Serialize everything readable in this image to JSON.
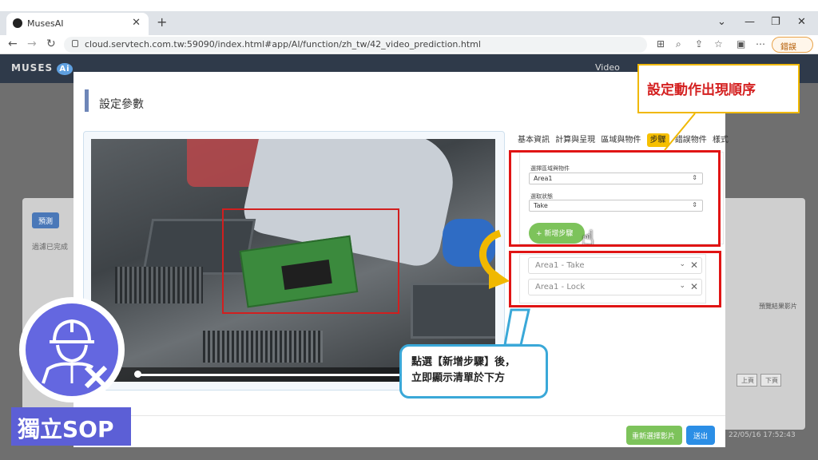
{
  "browser": {
    "tab_title": "MusesAI",
    "url": "cloud.servtech.com.tw:59090/index.html#app/AI/function/zh_tw/42_video_prediction.html",
    "profile_label": "錯誤"
  },
  "app": {
    "logo_text": "MUSES",
    "logo_badge": "Ai",
    "header_right": "Video"
  },
  "background": {
    "button_label": "預測",
    "filter_text": "過濾已完成",
    "column_text": "預覽結果影片",
    "pager_prev": "上頁",
    "pager_next": "下頁",
    "timestamp": "22/05/16 17:52:43"
  },
  "modal": {
    "title": "設定參數",
    "tabs": [
      "基本資訊",
      "計算與呈現",
      "區域與物件",
      "步驟",
      "錯誤物件",
      "樣式"
    ],
    "active_tab_index": 3,
    "form": {
      "area_label": "選擇區域與物件",
      "area_value": "Area1",
      "state_label": "選取狀態",
      "state_value": "Take",
      "add_step_button": "新增步驟"
    },
    "step_list": [
      "Area1 - Take",
      "Area1 - Lock"
    ],
    "footer": {
      "reselect_button": "重新選擇影片",
      "submit_button": "送出"
    }
  },
  "annotations": {
    "callout_top": "設定動作出現順序",
    "callout_bottom_line1": "點選【新增步驟】後，",
    "callout_bottom_line2": "立即顯示清單於下方"
  },
  "badge": {
    "label": "獨立SOP"
  },
  "colors": {
    "annotation_red": "#e01414",
    "active_tab": "#f6c000",
    "green_button": "#7dc35b",
    "blue_button": "#2b8ee6",
    "badge_purple": "#5c5fd6"
  }
}
